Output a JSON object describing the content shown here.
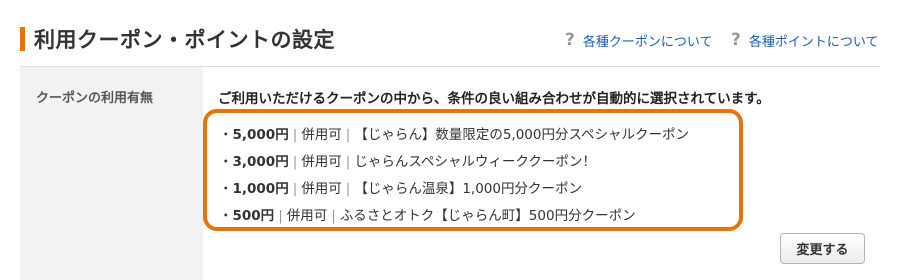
{
  "header": {
    "title": "利用クーポン・ポイントの設定",
    "links": [
      {
        "icon": "?",
        "label": "各種クーポンについて"
      },
      {
        "icon": "?",
        "label": "各種ポイントについて"
      }
    ]
  },
  "section": {
    "label": "クーポンの利用有無",
    "description": "ご利用いただけるクーポンの中から、条件の良い組み合わせが自動的に選択されています。",
    "coupons": [
      {
        "bullet": "・",
        "amount": "5,000円",
        "sep1": "|",
        "usage": "併用可",
        "sep2": "|",
        "name": "【じゃらん】数量限定の5,000円分スペシャルクーポン"
      },
      {
        "bullet": "・",
        "amount": "3,000円",
        "sep1": "|",
        "usage": "併用可",
        "sep2": "|",
        "name": "じゃらんスペシャルウィーククーポン！"
      },
      {
        "bullet": "・",
        "amount": "1,000円",
        "sep1": "|",
        "usage": "併用可",
        "sep2": "|",
        "name": "【じゃらん温泉】1,000円分クーポン"
      },
      {
        "bullet": "・",
        "amount": "500円",
        "sep1": "|",
        "usage": "併用可",
        "sep2": "|",
        "name": "ふるさとオトク【じゃらん町】500円分クーポン"
      }
    ],
    "change_button": "変更する"
  },
  "colors": {
    "accent": "#e8730c",
    "link": "#1a5fb4"
  }
}
